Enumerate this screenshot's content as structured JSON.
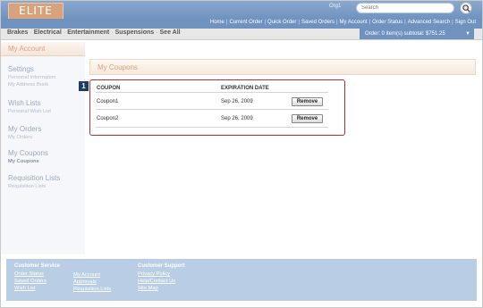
{
  "header": {
    "logo_text": "ELITE",
    "org_label": "Org1",
    "search_placeholder": "Search",
    "top_nav": [
      "Home",
      "Current Order",
      "Quick Order",
      "Saved Orders",
      "My Account",
      "Order Status",
      "Advanced Search",
      "Sign Out"
    ]
  },
  "categories": [
    "Brakes",
    "Electrical",
    "Entertainment",
    "Suspensions",
    "See All"
  ],
  "cart_summary": "Order: 0 item(s) subtotal: $751.25",
  "sidebar": {
    "title": "My Account",
    "groups": [
      {
        "heading": "Settings",
        "items": [
          "Personal Information",
          "My Address Book"
        ]
      },
      {
        "heading": "Wish Lists",
        "items": [
          "Personal Wish List"
        ]
      },
      {
        "heading": "My Orders",
        "items": [
          "My Orders"
        ]
      },
      {
        "heading": "My Coupons",
        "items": [
          "My Coupons"
        ]
      },
      {
        "heading": "Requisition Lists",
        "items": [
          "Requisition Lists"
        ]
      }
    ]
  },
  "main": {
    "title": "My Coupons",
    "callout_number": "1",
    "table": {
      "headers": [
        "COUPON",
        "EXPIRATION DATE"
      ],
      "rows": [
        {
          "coupon": "Coupon1",
          "expiration": "Sep 26, 2009",
          "action": "Remove"
        },
        {
          "coupon": "Coupon2",
          "expiration": "Sep 26, 2009",
          "action": "Remove"
        }
      ]
    }
  },
  "footer": {
    "customer_service": {
      "heading": "Customer Service",
      "col1": [
        "Order Status",
        "Saved Orders",
        "Wish List"
      ],
      "col2": [
        "My Account",
        "Approvals",
        "Requisition Lists"
      ]
    },
    "customer_support": {
      "heading": "Customer Support",
      "links": [
        "Privacy Policy",
        "Help/Contact Us",
        "Site Map"
      ]
    }
  },
  "colors": {
    "header_blue": "#6f92bf",
    "accent_tan": "#d8a27c",
    "highlight_red": "#aa3333",
    "footer_blue": "#b9cde4"
  }
}
